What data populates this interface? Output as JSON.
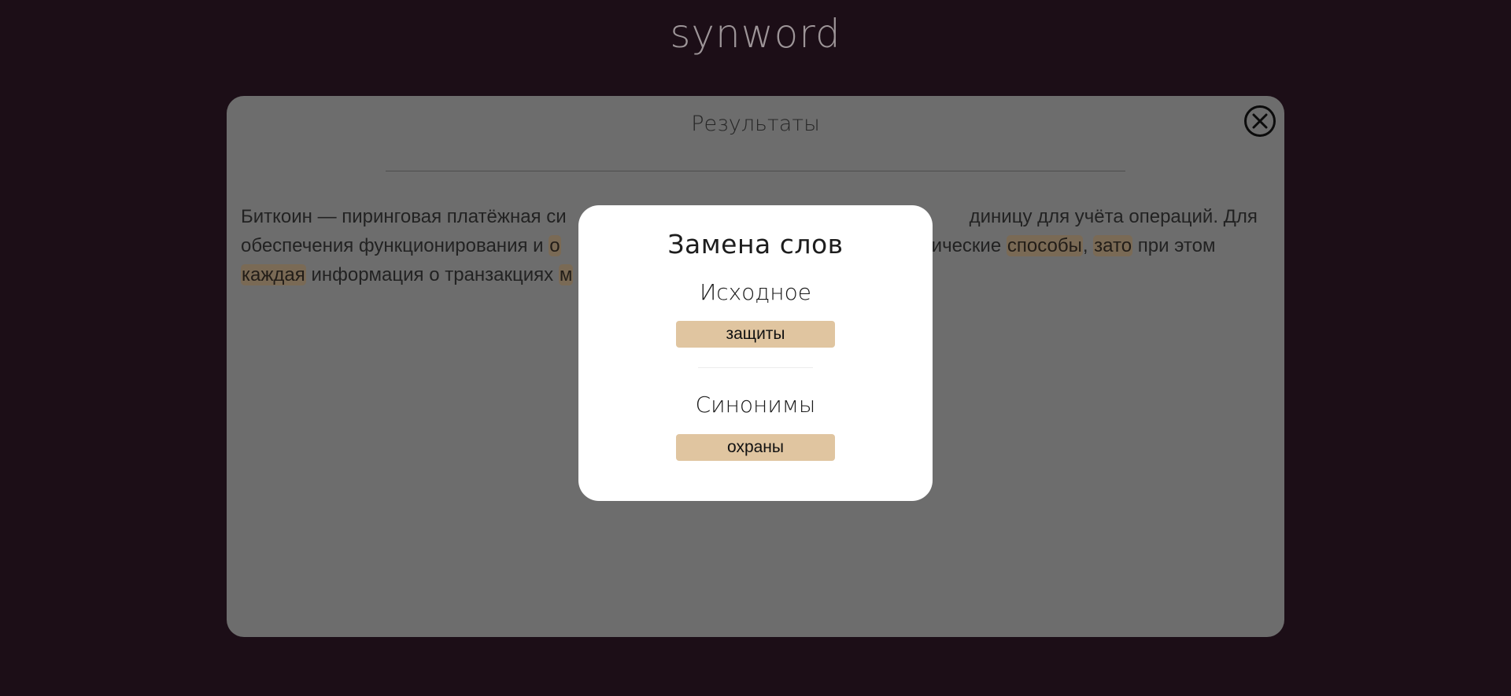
{
  "app": {
    "logo": "synword"
  },
  "results": {
    "title": "Результаты",
    "text": {
      "line1": "Биткоин — пиринговая платёжная си",
      "line1_end": "диницу для учёта операций. Для",
      "line2_start": "обеспечения функционирования и ",
      "line2_hl1": "о",
      "line2_mid": "афические ",
      "line2_hl2": "способы",
      "line2_comma": ", ",
      "line2_hl3": "зато",
      "line2_end": " при этом",
      "line3_hl1": "каждая",
      "line3_mid": " информация о транзакциях ",
      "line3_hl2": "м"
    }
  },
  "modal": {
    "title": "Замена слов",
    "original_label": "Исходное",
    "original_word": "защиты",
    "synonyms_label": "Синонимы",
    "synonyms": [
      "охраны"
    ]
  },
  "icons": {
    "close": "close-circle-icon"
  },
  "colors": {
    "background": "#1c0e17",
    "panel": "#6d6d6d",
    "highlight": "#7a6a55",
    "chip": "#e0c5a0",
    "modal": "#ffffff"
  }
}
